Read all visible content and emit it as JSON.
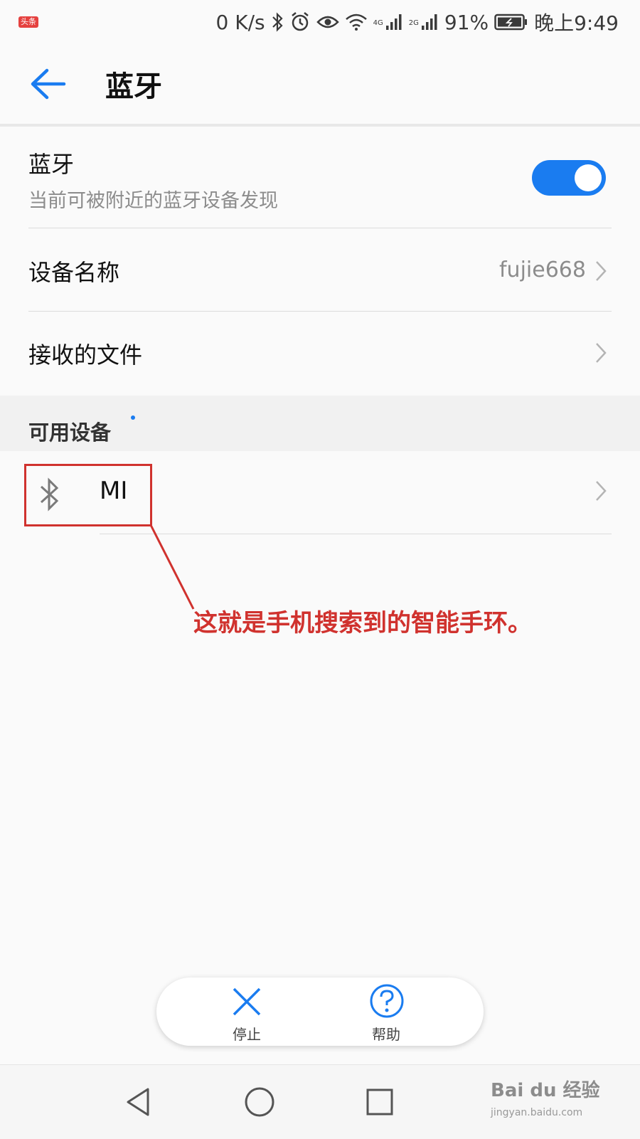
{
  "status_bar": {
    "badge": "头条",
    "net_speed": "0 K/s",
    "net1": "4G",
    "net2": "2G",
    "battery": "91%",
    "time": "晚上9:49"
  },
  "header": {
    "title": "蓝牙"
  },
  "bluetooth": {
    "title": "蓝牙",
    "subtitle": "当前可被附近的蓝牙设备发现",
    "enabled": true
  },
  "device_name": {
    "label": "设备名称",
    "value": "fujie668"
  },
  "received_files": {
    "label": "接收的文件"
  },
  "available_section": {
    "title": "可用设备"
  },
  "devices": [
    {
      "name": "MI"
    }
  ],
  "annotation": {
    "text": "这就是手机搜索到的智能手环。"
  },
  "actions": {
    "stop": "停止",
    "help": "帮助"
  },
  "watermark": {
    "brand": "Bai du 经验",
    "sub": "jingyan.baidu.com"
  },
  "colors": {
    "accent": "#1a7cf0",
    "annotation": "#d0322e"
  }
}
